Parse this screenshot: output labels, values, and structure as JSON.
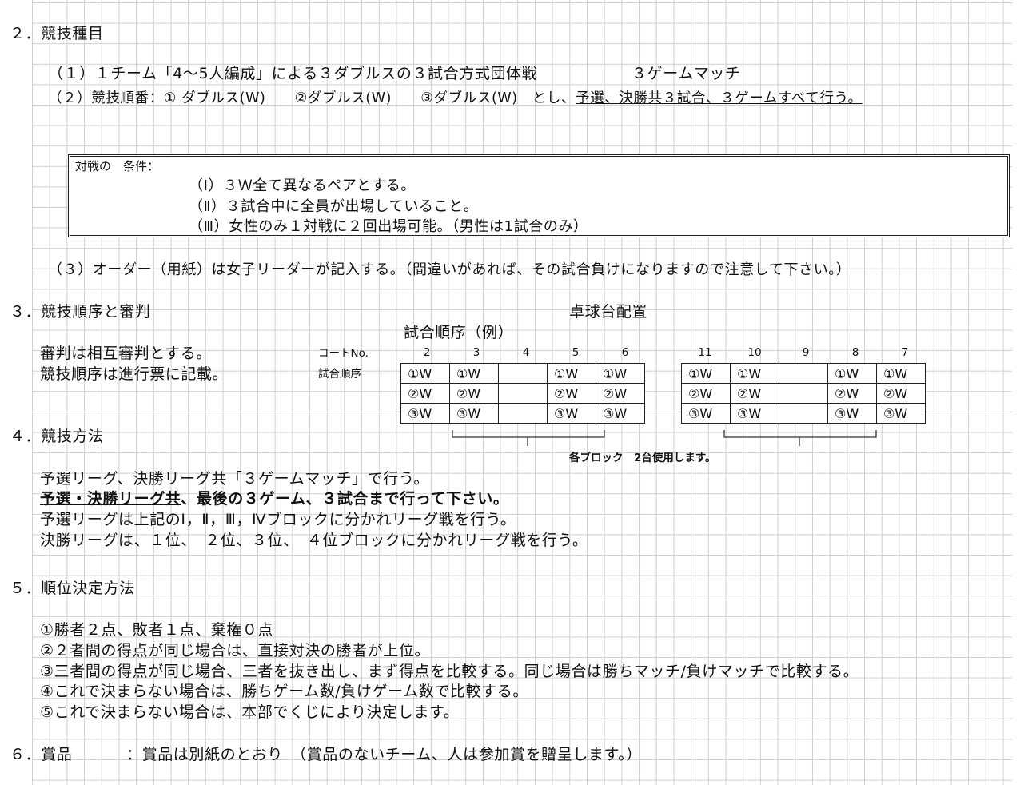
{
  "s2": {
    "title": "２．競技種目",
    "line1_a": "（１）１チーム「4〜5人編成」による３ダブルスの３試合方式団体戦",
    "line1_b": "３ゲームマッチ",
    "line2_a": "（２）競技順番：① ダブルス(W)　　②ダブルス(W)　　③ダブルス(W)　とし、",
    "line2_b": "予選、決勝共３試合、３ゲームすべて行う。",
    "cond_label": "対戦の　条件：",
    "cond": [
      "（Ⅰ）３Ｗ全て異なるペアとする。",
      "（Ⅱ）３試合中に全員が出場していること。",
      "（Ⅲ）女性のみ１対戦に２回出場可能。（男性は1試合のみ）"
    ],
    "line3": "（３）オーダー（用紙）は女子リーダーが記入する。（間違いがあれば、その試合負けになりますので注意して下さい。）"
  },
  "s3": {
    "title": "３．競技順序と審判",
    "ref": "審判は相互審判とする。",
    "order": "競技順序は進行票に記載。",
    "table_title": "卓球台配置",
    "example": "試合順序（例）",
    "court_label": "コートNo.",
    "order_label": "試合順序",
    "courts_left": [
      "2",
      "3",
      "4",
      "5",
      "6"
    ],
    "courts_right": [
      "11",
      "10",
      "9",
      "8",
      "7"
    ],
    "rows_left": [
      [
        "①W",
        "①W",
        "",
        "①W",
        "①W"
      ],
      [
        "②W",
        "②W",
        "",
        "②W",
        "②W"
      ],
      [
        "③W",
        "③W",
        "",
        "③W",
        "③W"
      ]
    ],
    "rows_right": [
      [
        "①W",
        "①W",
        "",
        "①W",
        "①W"
      ],
      [
        "②W",
        "②W",
        "",
        "②W",
        "②W"
      ],
      [
        "③W",
        "③W",
        "",
        "③W",
        "③W"
      ]
    ],
    "note": "各ブロック　2台使用します。"
  },
  "s4": {
    "title": "４．競技方法",
    "l1": "予選リーグ、決勝リーグ共「３ゲームマッチ」で行う。",
    "l2_a": "予選・決勝リーグ共",
    "l2_b": "、最後の３ゲーム、３試合まで行って下さい。",
    "l3": "予選リーグは上記のⅠ，Ⅱ，Ⅲ，Ⅳブロックに分かれリーグ戦を行う。",
    "l4": "決勝リーグは、１位、　２位、３位、　４位ブロックに分かれリーグ戦を行う。"
  },
  "s5": {
    "title": "５．順位決定方法",
    "items": [
      "①勝者２点、敗者１点、棄権０点",
      "②２者間の得点が同じ場合は、直接対決の勝者が上位。",
      "③三者間の得点が同じ場合、三者を抜き出し、まず得点を比較する。同じ場合は勝ちマッチ/負けマッチで比較する。",
      "④これで決まらない場合は、勝ちゲーム数/負けゲーム数で比較する。",
      "⑤これで決まらない場合は、本部でくじにより決定します。"
    ]
  },
  "s6": {
    "title": "６．賞品",
    "text": "：賞品は別紙のとおり　（賞品のないチーム、人は参加賞を贈呈します。）"
  }
}
